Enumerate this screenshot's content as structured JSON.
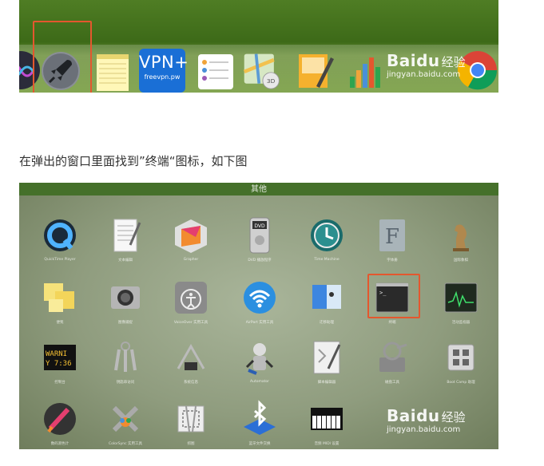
{
  "caption": "在弹出的窗口里面找到”终端“图标，如下图",
  "watermark": {
    "brand": "Bai",
    "paw": "du",
    "cn": "经验",
    "url": "jingyan.baidu.com"
  },
  "dock": {
    "vpn_label": "VPN+",
    "vpn_sub": "freevpn.pw",
    "items": [
      "siri-icon",
      "launchpad-rocket-icon",
      "notes-icon",
      "vpn-plus-icon",
      "reminders-icon",
      "maps-icon",
      "pages-icon",
      "numbers-icon",
      "chrome-icon"
    ]
  },
  "launchpad": {
    "folder_title": "其他",
    "apps": [
      {
        "icon": "quicktime-icon",
        "label": "QuickTime Player"
      },
      {
        "icon": "textedit-icon",
        "label": "文本编辑"
      },
      {
        "icon": "grapher-icon",
        "label": "Grapher"
      },
      {
        "icon": "dvd-player-icon",
        "label": "DVD 播放程序"
      },
      {
        "icon": "time-machine-icon",
        "label": "Time Machine"
      },
      {
        "icon": "font-book-icon",
        "label": "字体册"
      },
      {
        "icon": "chess-icon",
        "label": "国际象棋"
      },
      {
        "icon": "stickies-icon",
        "label": "便笺"
      },
      {
        "icon": "image-capture-icon",
        "label": "图像捕捉"
      },
      {
        "icon": "voiceover-utility-icon",
        "label": "VoiceOver 实用工具"
      },
      {
        "icon": "airport-utility-icon",
        "label": "AirPort 实用工具"
      },
      {
        "icon": "migration-assistant-icon",
        "label": "迁移助理"
      },
      {
        "icon": "terminal-icon",
        "label": "终端"
      },
      {
        "icon": "activity-monitor-icon",
        "label": "活动监视器"
      },
      {
        "icon": "console-icon",
        "label": "控制台"
      },
      {
        "icon": "keychain-access-icon",
        "label": "钥匙串访问"
      },
      {
        "icon": "system-information-icon",
        "label": "系统信息"
      },
      {
        "icon": "automator-icon",
        "label": "Automator"
      },
      {
        "icon": "script-editor-icon",
        "label": "脚本编辑器"
      },
      {
        "icon": "disk-utility-icon",
        "label": "磁盘工具"
      },
      {
        "icon": "boot-camp-icon",
        "label": "Boot Camp 助理"
      },
      {
        "icon": "digital-color-meter-icon",
        "label": "数码测色计"
      },
      {
        "icon": "colorsync-utility-icon",
        "label": "ColorSync 实用工具"
      },
      {
        "icon": "grab-icon",
        "label": "抓图"
      },
      {
        "icon": "bluetooth-file-exchange-icon",
        "label": "蓝牙文件交换"
      },
      {
        "icon": "audio-midi-setup-icon",
        "label": "音频 MIDI 设置"
      }
    ]
  }
}
